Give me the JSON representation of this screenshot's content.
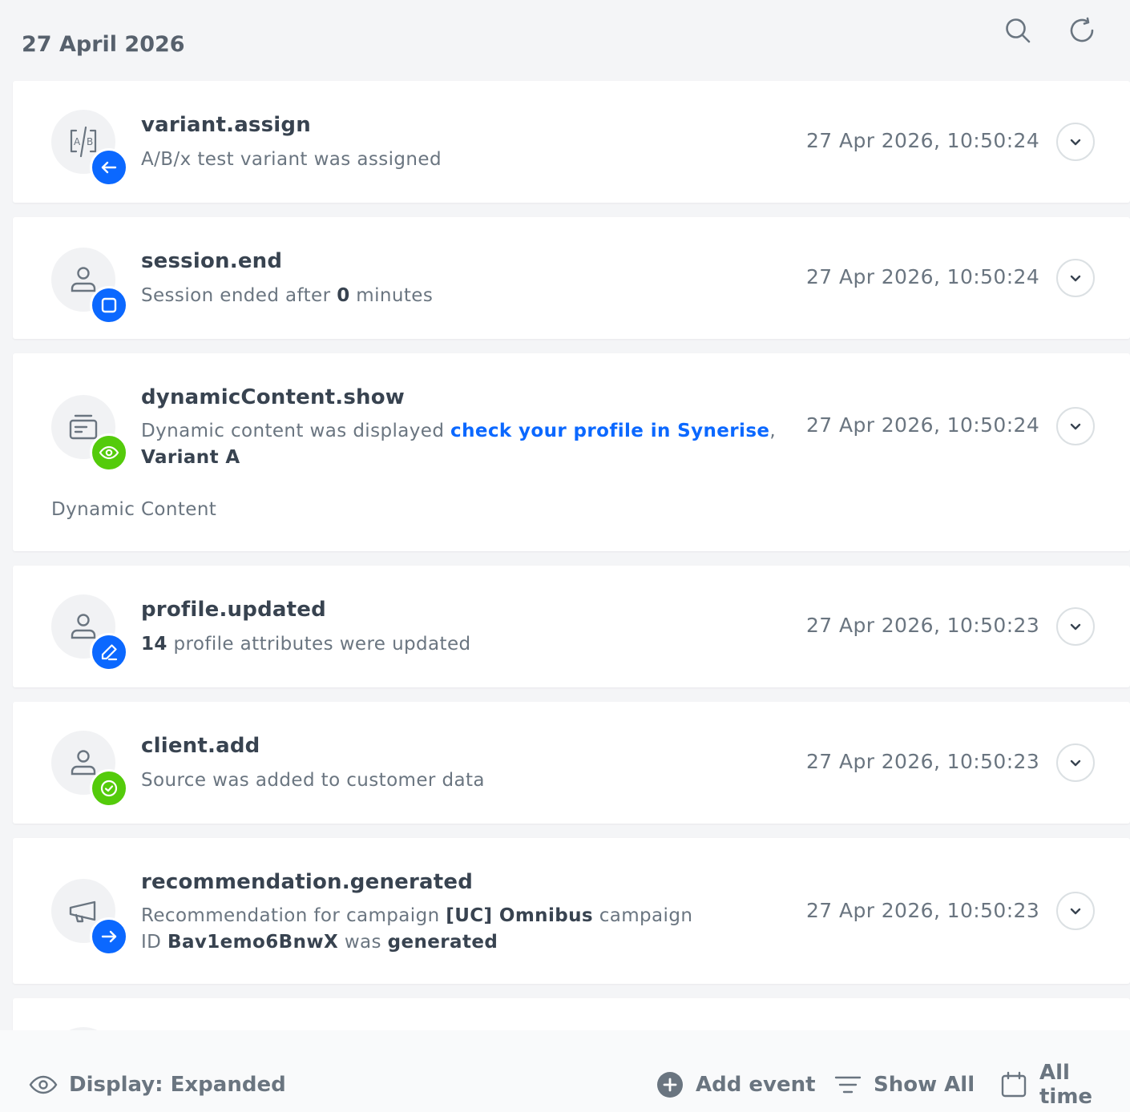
{
  "header": {
    "date": "27 April 2026",
    "search_icon": "search-icon",
    "refresh_icon": "refresh-icon"
  },
  "events": [
    {
      "title": "variant.assign",
      "description": "A/B/x test variant was assigned",
      "time": "27 Apr 2026, 10:50:24",
      "icon": "ab-test-icon",
      "badge_icon": "arrow-left-icon",
      "badge_color": "#0b68ff"
    },
    {
      "title": "session.end",
      "description_prefix": "Session ended after ",
      "description_value": "0",
      "description_suffix": " minutes",
      "time": "27 Apr 2026, 10:50:24",
      "icon": "user-icon",
      "badge_icon": "stop-square-icon",
      "badge_color": "#0b68ff"
    },
    {
      "title": "dynamicContent.show",
      "description_prefix": "Dynamic content was displayed ",
      "description_link": "check your profile in Synerise",
      "description_sep": ", ",
      "description_variant": "Variant A",
      "category": "Dynamic Content",
      "time": "27 Apr 2026, 10:50:24",
      "icon": "dynamic-content-icon",
      "badge_icon": "eye-icon",
      "badge_color": "#54cb0b"
    },
    {
      "title": "profile.updated",
      "description_count": "14",
      "description_suffix": " profile attributes were updated",
      "time": "27 Apr 2026, 10:50:23",
      "icon": "user-icon",
      "badge_icon": "pencil-icon",
      "badge_color": "#0b68ff"
    },
    {
      "title": "client.add",
      "description": "Source was added to customer data",
      "time": "27 Apr 2026, 10:50:23",
      "icon": "user-icon",
      "badge_icon": "check-circle-icon",
      "badge_color": "#54cb0b"
    },
    {
      "title": "recommendation.generated",
      "description_prefix": "Recommendation for campaign ",
      "description_campaign": "[UC] Omnibus",
      "description_mid": " campaign ID ",
      "description_id": "Bav1emo6BnwX",
      "description_was": " was ",
      "description_status": "generated",
      "time": "27 Apr 2026, 10:50:23",
      "icon": "megaphone-icon",
      "badge_icon": "arrow-right-icon",
      "badge_color": "#0b68ff"
    }
  ],
  "footer": {
    "display_label": "Display: Expanded",
    "add_event_label": "Add event",
    "show_all_label": "Show All",
    "all_time_label": "All time"
  }
}
